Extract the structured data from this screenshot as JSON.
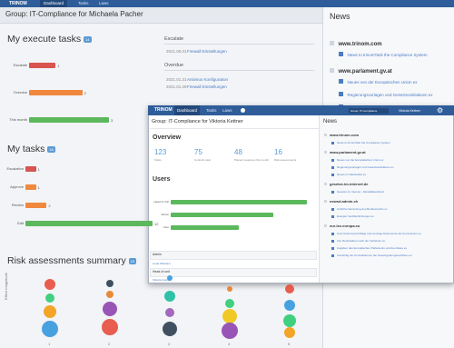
{
  "app": {
    "brand": "TRINOM",
    "tabs": [
      "Dashboard",
      "Tasks",
      "Laws"
    ],
    "active_tab": "Dashboard"
  },
  "group_title": "Group: IT-Compliance for Michaela Pacher",
  "execute": {
    "title": "My execute tasks",
    "badge": "14",
    "bars": [
      {
        "label": "Escalate",
        "value": 1,
        "color": "#d9534f"
      },
      {
        "label": "Overdue",
        "value": 2,
        "color": "#f0883e"
      },
      {
        "label": "This month",
        "value": 3,
        "color": "#5cb85c"
      }
    ],
    "escalate_title": "Escalate",
    "escalate_item_date": "2021.05.01",
    "escalate_item_link": "Firewall Einstellungen",
    "overdue_title": "Overdue",
    "overdue_items": [
      {
        "date": "2021.01.31",
        "link": "Antivirus Konfiguration"
      },
      {
        "date": "2021.01.29",
        "link": "Firewall Einstellungen"
      }
    ]
  },
  "mytasks": {
    "title": "My tasks",
    "badge": "16",
    "bars": [
      {
        "label": "Escalation",
        "value": 1,
        "color": "#d9534f"
      },
      {
        "label": "Approve",
        "value": 1,
        "color": "#f0883e"
      },
      {
        "label": "Review",
        "value": 2,
        "color": "#f0883e"
      },
      {
        "label": "Edit",
        "value": 12,
        "color": "#5cb85c"
      }
    ]
  },
  "risk": {
    "title": "Risk assessments summary",
    "badge": "15",
    "y_label": "Effect magnitude",
    "x_ticks": [
      "1",
      "2",
      "3",
      "4",
      "5"
    ]
  },
  "news": {
    "title": "News",
    "sites": [
      {
        "name": "www.trinom.com",
        "items": [
          "News to trinomTask the Compliance System"
        ]
      },
      {
        "name": "www.parlament.gv.at",
        "items": [
          "Neues von der Europäischen Union ex",
          "Regierungsvorlagen und Gesetzesinitiativen ex",
          "Neues im Nationalrat ex"
        ]
      }
    ]
  },
  "front": {
    "brand": "TRINOM",
    "tabs": [
      "Dashboard",
      "Tasks",
      "Laws"
    ],
    "group_select": "Group: IT-Compliance",
    "user": "Viktoria Kettner",
    "group_title": "Group: IT-Compliance for Viktoria Kettner",
    "overview_title": "Overview",
    "stats": [
      {
        "num": "123",
        "label": "Tasks"
      },
      {
        "num": "75",
        "label": "Controls total"
      },
      {
        "num": "48",
        "label": "Planed measures this month"
      },
      {
        "num": "16",
        "label": "Risk assessments"
      }
    ],
    "users_title": "Users",
    "users_bars": [
      {
        "label": "Head of Unit",
        "value": 4,
        "color": "#5cb85c"
      },
      {
        "label": "Admin",
        "value": 3,
        "color": "#5cb85c"
      },
      {
        "label": "User",
        "value": 2,
        "color": "#5cb85c"
      }
    ],
    "admin_label": "Admin",
    "admin_link": "Lusia Wiestaur",
    "head_label": "Head of unit",
    "head_link": "Viktoria Kettner",
    "news_title": "News",
    "news": [
      {
        "site": "www.trinom.com",
        "items": [
          "News to trinomTask the Compliance System"
        ]
      },
      {
        "site": "www.parlament.gv.at",
        "items": [
          "Neues von der Europäischen Union ex",
          "Regierungsvorlagen und Gesetzesinitiativen ex",
          "Neues im Nationalrat ex"
        ]
      },
      {
        "site": "gesetze-im-internet.de",
        "items": [
          "Gesetze im Internet - Aktualitätendienst"
        ]
      },
      {
        "site": "newsd.admin.ch",
        "items": [
          "Amtliche Sammlung des Bundesrechts ex",
          "Energie/ Veröffentlichungen ex"
        ]
      },
      {
        "site": "eur-lex.europa.eu",
        "items": [
          "Kommissionsvorschläge und sonstige Dokumente der Kommission ex",
          "Von Rechtsakten nach der Verfahren ex",
          "Angaben des Europäischen Parlaments und des Rates ex",
          "Vorschlag der Konsultationen der Gesetzgebungsverfahren ex"
        ]
      }
    ]
  }
}
